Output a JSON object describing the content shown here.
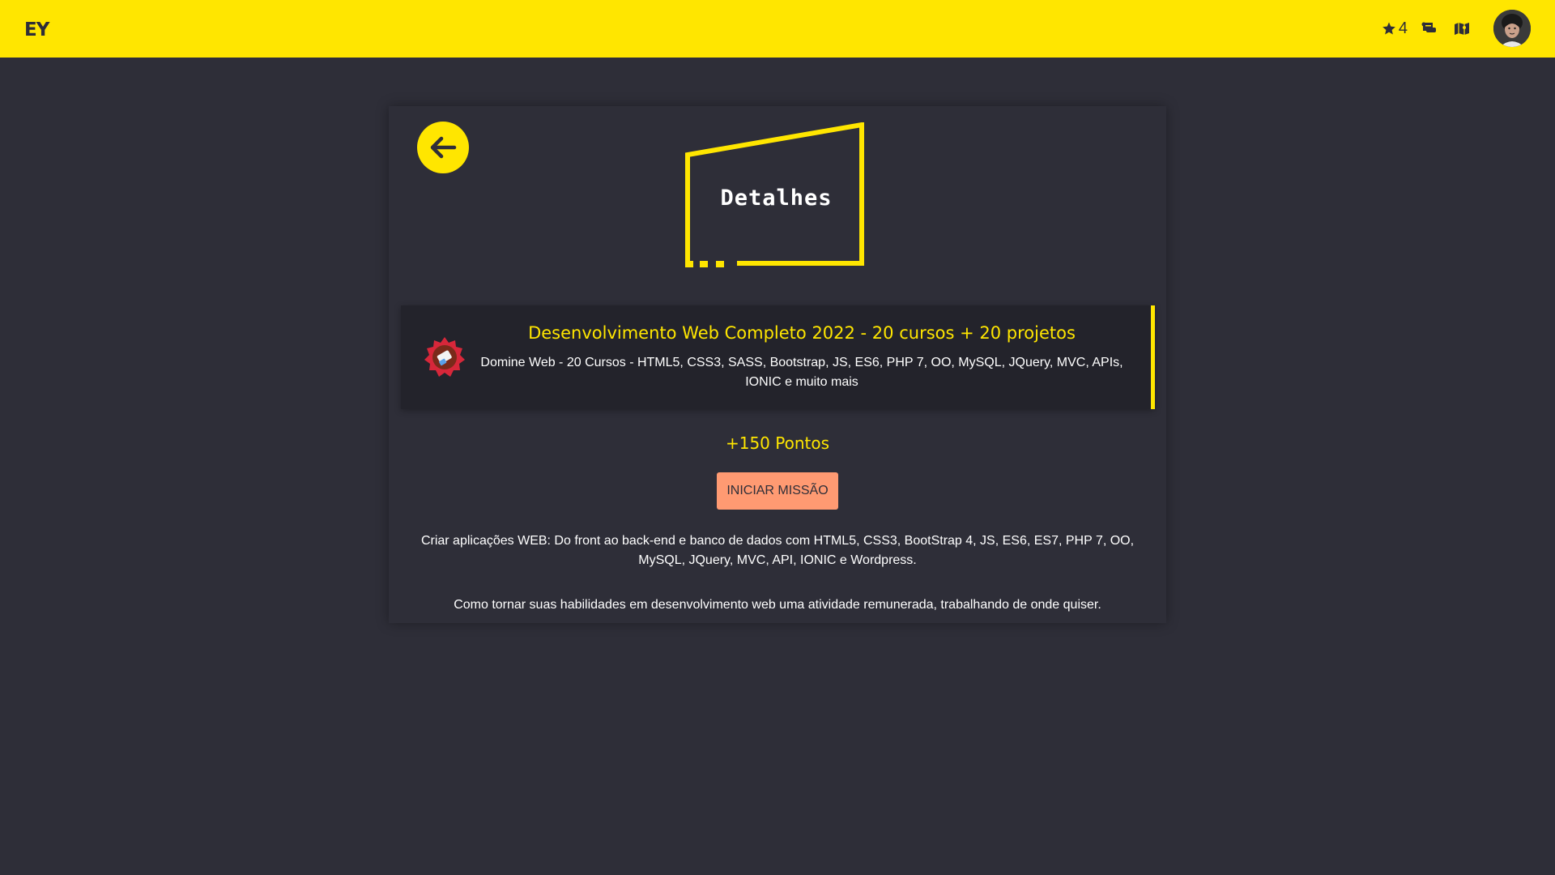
{
  "header": {
    "brand": "EY",
    "stars_count": "4",
    "icons": [
      "star-icon",
      "scroll-icon",
      "map-icon"
    ],
    "avatar": "user-avatar"
  },
  "page": {
    "back_icon": "arrow-left-icon",
    "title": "Detalhes"
  },
  "course": {
    "badge_icon": "mission-badge-icon",
    "title": "Desenvolvimento Web Completo 2022 - 20 cursos + 20 projetos",
    "subtitle": "Domine Web - 20 Cursos - HTML5, CSS3, SASS, Bootstrap, JS, ES6, PHP 7, OO, MySQL, JQuery, MVC, APIs, IONIC e muito mais"
  },
  "points": "+150 Pontos",
  "start_button": "INICIAR MISSÃO",
  "descriptions": {
    "line1": "Criar aplicações WEB: Do front ao back-end e banco de dados com HTML5, CSS3, BootStrap 4, JS, ES6, ES7, PHP 7, OO, MySQL, JQuery, MVC, API, IONIC e Wordpress.",
    "line2": "Como tornar suas habilidades em desenvolvimento web uma atividade remunerada, trabalhando de onde quiser."
  },
  "colors": {
    "accent": "#ffe600",
    "background": "#2e2e38",
    "button": "#ff9a72"
  }
}
